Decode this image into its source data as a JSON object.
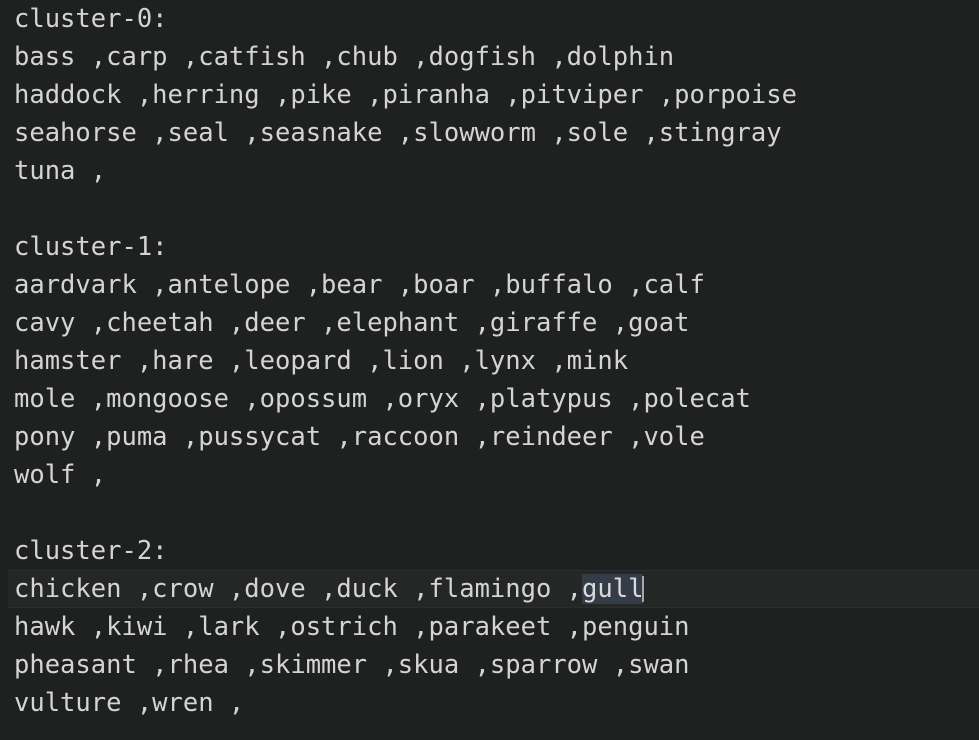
{
  "editor": {
    "background_color": "#1f2020",
    "text_color": "#d4d4d4",
    "active_line_background": "#252626",
    "selection_background": "#343c48",
    "caret_color": "#a6a6a6"
  },
  "lines": [
    {
      "id": "l1",
      "text": "cluster-0:"
    },
    {
      "id": "l2",
      "text": "bass ,carp ,catfish ,chub ,dogfish ,dolphin"
    },
    {
      "id": "l3",
      "text": "haddock ,herring ,pike ,piranha ,pitviper ,porpoise"
    },
    {
      "id": "l4",
      "text": "seahorse ,seal ,seasnake ,slowworm ,sole ,stingray"
    },
    {
      "id": "l5",
      "text": "tuna ,"
    },
    {
      "id": "l6",
      "text": ""
    },
    {
      "id": "l7",
      "text": "cluster-1:"
    },
    {
      "id": "l8",
      "text": "aardvark ,antelope ,bear ,boar ,buffalo ,calf"
    },
    {
      "id": "l9",
      "text": "cavy ,cheetah ,deer ,elephant ,giraffe ,goat"
    },
    {
      "id": "l10",
      "text": "hamster ,hare ,leopard ,lion ,lynx ,mink"
    },
    {
      "id": "l11",
      "text": "mole ,mongoose ,opossum ,oryx ,platypus ,polecat"
    },
    {
      "id": "l12",
      "text": "pony ,puma ,pussycat ,raccoon ,reindeer ,vole"
    },
    {
      "id": "l13",
      "text": "wolf ,"
    },
    {
      "id": "l14",
      "text": ""
    },
    {
      "id": "l15",
      "text": "cluster-2:"
    },
    {
      "id": "l17",
      "text": "hawk ,kiwi ,lark ,ostrich ,parakeet ,penguin"
    },
    {
      "id": "l18",
      "text": "pheasant ,rhea ,skimmer ,skua ,sparrow ,swan"
    },
    {
      "id": "l19",
      "text": "vulture ,wren ,"
    }
  ],
  "active_line": {
    "before_selection": "chicken ,crow ,dove ,duck ,flamingo ,",
    "selected_text": "gull",
    "after_selection": ""
  },
  "clusters": [
    {
      "label": "cluster-0:",
      "members": [
        "bass",
        "carp",
        "catfish",
        "chub",
        "dogfish",
        "dolphin",
        "haddock",
        "herring",
        "pike",
        "piranha",
        "pitviper",
        "porpoise",
        "seahorse",
        "seal",
        "seasnake",
        "slowworm",
        "sole",
        "stingray",
        "tuna"
      ]
    },
    {
      "label": "cluster-1:",
      "members": [
        "aardvark",
        "antelope",
        "bear",
        "boar",
        "buffalo",
        "calf",
        "cavy",
        "cheetah",
        "deer",
        "elephant",
        "giraffe",
        "goat",
        "hamster",
        "hare",
        "leopard",
        "lion",
        "lynx",
        "mink",
        "mole",
        "mongoose",
        "opossum",
        "oryx",
        "platypus",
        "polecat",
        "pony",
        "puma",
        "pussycat",
        "raccoon",
        "reindeer",
        "vole",
        "wolf"
      ]
    },
    {
      "label": "cluster-2:",
      "members": [
        "chicken",
        "crow",
        "dove",
        "duck",
        "flamingo",
        "gull",
        "hawk",
        "kiwi",
        "lark",
        "ostrich",
        "parakeet",
        "penguin",
        "pheasant",
        "rhea",
        "skimmer",
        "skua",
        "sparrow",
        "swan",
        "vulture",
        "wren"
      ]
    }
  ]
}
